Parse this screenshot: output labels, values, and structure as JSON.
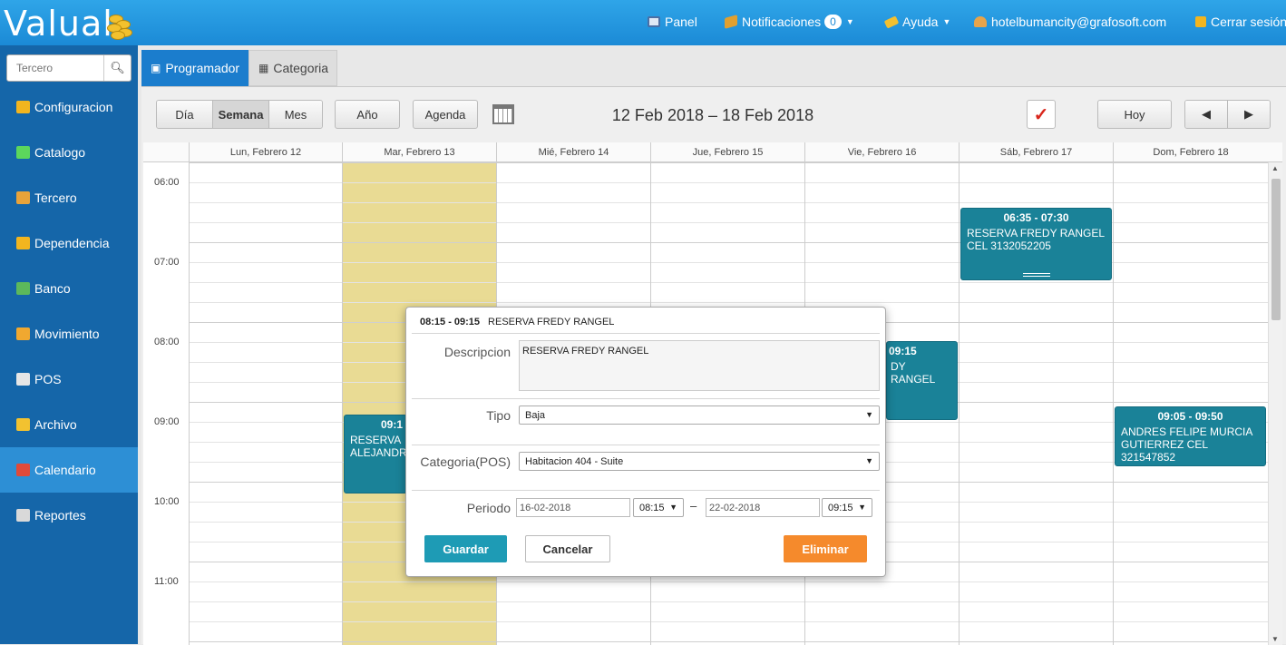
{
  "app": {
    "logo": "Valual"
  },
  "topnav": {
    "panel": "Panel",
    "notificaciones": "Notificaciones",
    "notif_count": "0",
    "ayuda": "Ayuda",
    "user": "hotelbumancity@grafosoft.com",
    "logout": "Cerrar sesión"
  },
  "sidebar": {
    "search_placeholder": "Tercero",
    "items": [
      {
        "label": "Configuracion",
        "icon": "gear-icon",
        "color": "#f2b51f"
      },
      {
        "label": "Catalogo",
        "icon": "share-nodes-icon",
        "color": "#5cd65c"
      },
      {
        "label": "Tercero",
        "icon": "people-icon",
        "color": "#e8a33a"
      },
      {
        "label": "Dependencia",
        "icon": "blocks-icon",
        "color": "#f2b51f"
      },
      {
        "label": "Banco",
        "icon": "bank-icon",
        "color": "#5cb85c"
      },
      {
        "label": "Movimiento",
        "icon": "cubes-icon",
        "color": "#f0a830"
      },
      {
        "label": "POS",
        "icon": "pos-icon",
        "color": "#e6e6e6"
      },
      {
        "label": "Archivo",
        "icon": "folder-icon",
        "color": "#f2c230"
      },
      {
        "label": "Calendario",
        "icon": "calendar-icon",
        "color": "#e04a3a"
      },
      {
        "label": "Reportes",
        "icon": "printer-icon",
        "color": "#d9d9d9"
      }
    ],
    "active_index": 8
  },
  "tabs": [
    {
      "label": "Programador",
      "icon": "calendar-icon"
    },
    {
      "label": "Categoria",
      "icon": "grid-icon"
    }
  ],
  "toolbar": {
    "views": [
      "Día",
      "Semana",
      "Mes"
    ],
    "selected_view": "Semana",
    "year": "Año",
    "agenda": "Agenda",
    "range": "12 Feb 2018 – 18 Feb 2018",
    "today": "Hoy",
    "prev": "◀",
    "next": "▶"
  },
  "calendar": {
    "days": [
      "Lun, Febrero 12",
      "Mar, Febrero 13",
      "Mié, Febrero 14",
      "Jue, Febrero 15",
      "Vie, Febrero 16",
      "Sáb, Febrero 17",
      "Dom, Febrero 18"
    ],
    "hours": [
      "06:00",
      "07:00",
      "08:00",
      "09:00",
      "10:00",
      "11:00"
    ],
    "today_color": "#e9db94",
    "event_color": "#1a8298",
    "events": [
      {
        "time": "06:35 - 07:30",
        "title": "RESERVA FREDY RANGEL CEL 3132052205"
      },
      {
        "time": "09:05 - 09:50",
        "title": "ANDRES FELIPE MURCIA GUTIERREZ CEL 321547852"
      },
      {
        "time": "09:1",
        "title": "RESERVA ALEJANDR"
      },
      {
        "time": "09:15",
        "title": "DY RANGEL"
      }
    ]
  },
  "dialog": {
    "time": "08:15 - 09:15",
    "title": "RESERVA FREDY RANGEL",
    "descripcion_label": "Descripcion",
    "descripcion_value": "RESERVA FREDY RANGEL",
    "tipo_label": "Tipo",
    "tipo_value": "Baja",
    "categoria_label": "Categoria(POS)",
    "categoria_value": "Habitacion 404 - Suite",
    "periodo_label": "Periodo",
    "start_date": "16-02-2018",
    "start_time": "08:15",
    "dash": "–",
    "end_date": "22-02-2018",
    "end_time": "09:15",
    "guardar": "Guardar",
    "cancelar": "Cancelar",
    "eliminar": "Eliminar",
    "guardar_color": "#1e9bb5",
    "eliminar_color": "#f58a2c"
  }
}
